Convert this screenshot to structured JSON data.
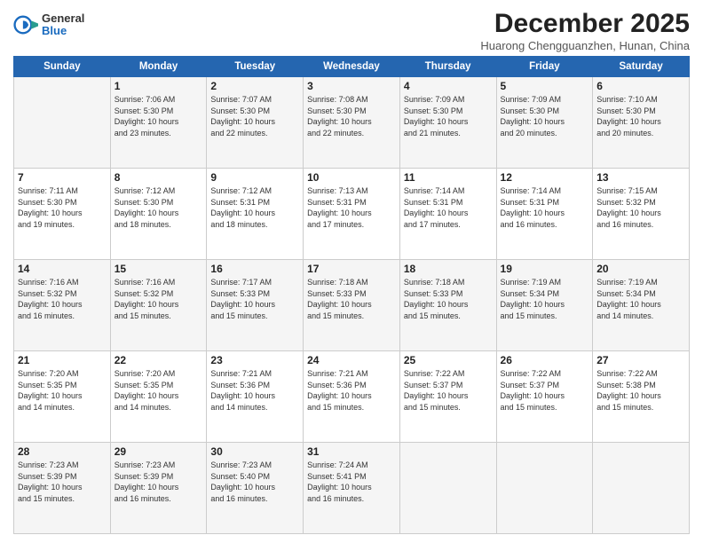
{
  "header": {
    "logo_general": "General",
    "logo_blue": "Blue",
    "month_title": "December 2025",
    "location": "Huarong Chengguanzhen, Hunan, China"
  },
  "days_of_week": [
    "Sunday",
    "Monday",
    "Tuesday",
    "Wednesday",
    "Thursday",
    "Friday",
    "Saturday"
  ],
  "weeks": [
    [
      {
        "day": "",
        "info": ""
      },
      {
        "day": "1",
        "info": "Sunrise: 7:06 AM\nSunset: 5:30 PM\nDaylight: 10 hours\nand 23 minutes."
      },
      {
        "day": "2",
        "info": "Sunrise: 7:07 AM\nSunset: 5:30 PM\nDaylight: 10 hours\nand 22 minutes."
      },
      {
        "day": "3",
        "info": "Sunrise: 7:08 AM\nSunset: 5:30 PM\nDaylight: 10 hours\nand 22 minutes."
      },
      {
        "day": "4",
        "info": "Sunrise: 7:09 AM\nSunset: 5:30 PM\nDaylight: 10 hours\nand 21 minutes."
      },
      {
        "day": "5",
        "info": "Sunrise: 7:09 AM\nSunset: 5:30 PM\nDaylight: 10 hours\nand 20 minutes."
      },
      {
        "day": "6",
        "info": "Sunrise: 7:10 AM\nSunset: 5:30 PM\nDaylight: 10 hours\nand 20 minutes."
      }
    ],
    [
      {
        "day": "7",
        "info": "Sunrise: 7:11 AM\nSunset: 5:30 PM\nDaylight: 10 hours\nand 19 minutes."
      },
      {
        "day": "8",
        "info": "Sunrise: 7:12 AM\nSunset: 5:30 PM\nDaylight: 10 hours\nand 18 minutes."
      },
      {
        "day": "9",
        "info": "Sunrise: 7:12 AM\nSunset: 5:31 PM\nDaylight: 10 hours\nand 18 minutes."
      },
      {
        "day": "10",
        "info": "Sunrise: 7:13 AM\nSunset: 5:31 PM\nDaylight: 10 hours\nand 17 minutes."
      },
      {
        "day": "11",
        "info": "Sunrise: 7:14 AM\nSunset: 5:31 PM\nDaylight: 10 hours\nand 17 minutes."
      },
      {
        "day": "12",
        "info": "Sunrise: 7:14 AM\nSunset: 5:31 PM\nDaylight: 10 hours\nand 16 minutes."
      },
      {
        "day": "13",
        "info": "Sunrise: 7:15 AM\nSunset: 5:32 PM\nDaylight: 10 hours\nand 16 minutes."
      }
    ],
    [
      {
        "day": "14",
        "info": "Sunrise: 7:16 AM\nSunset: 5:32 PM\nDaylight: 10 hours\nand 16 minutes."
      },
      {
        "day": "15",
        "info": "Sunrise: 7:16 AM\nSunset: 5:32 PM\nDaylight: 10 hours\nand 15 minutes."
      },
      {
        "day": "16",
        "info": "Sunrise: 7:17 AM\nSunset: 5:33 PM\nDaylight: 10 hours\nand 15 minutes."
      },
      {
        "day": "17",
        "info": "Sunrise: 7:18 AM\nSunset: 5:33 PM\nDaylight: 10 hours\nand 15 minutes."
      },
      {
        "day": "18",
        "info": "Sunrise: 7:18 AM\nSunset: 5:33 PM\nDaylight: 10 hours\nand 15 minutes."
      },
      {
        "day": "19",
        "info": "Sunrise: 7:19 AM\nSunset: 5:34 PM\nDaylight: 10 hours\nand 15 minutes."
      },
      {
        "day": "20",
        "info": "Sunrise: 7:19 AM\nSunset: 5:34 PM\nDaylight: 10 hours\nand 14 minutes."
      }
    ],
    [
      {
        "day": "21",
        "info": "Sunrise: 7:20 AM\nSunset: 5:35 PM\nDaylight: 10 hours\nand 14 minutes."
      },
      {
        "day": "22",
        "info": "Sunrise: 7:20 AM\nSunset: 5:35 PM\nDaylight: 10 hours\nand 14 minutes."
      },
      {
        "day": "23",
        "info": "Sunrise: 7:21 AM\nSunset: 5:36 PM\nDaylight: 10 hours\nand 14 minutes."
      },
      {
        "day": "24",
        "info": "Sunrise: 7:21 AM\nSunset: 5:36 PM\nDaylight: 10 hours\nand 15 minutes."
      },
      {
        "day": "25",
        "info": "Sunrise: 7:22 AM\nSunset: 5:37 PM\nDaylight: 10 hours\nand 15 minutes."
      },
      {
        "day": "26",
        "info": "Sunrise: 7:22 AM\nSunset: 5:37 PM\nDaylight: 10 hours\nand 15 minutes."
      },
      {
        "day": "27",
        "info": "Sunrise: 7:22 AM\nSunset: 5:38 PM\nDaylight: 10 hours\nand 15 minutes."
      }
    ],
    [
      {
        "day": "28",
        "info": "Sunrise: 7:23 AM\nSunset: 5:39 PM\nDaylight: 10 hours\nand 15 minutes."
      },
      {
        "day": "29",
        "info": "Sunrise: 7:23 AM\nSunset: 5:39 PM\nDaylight: 10 hours\nand 16 minutes."
      },
      {
        "day": "30",
        "info": "Sunrise: 7:23 AM\nSunset: 5:40 PM\nDaylight: 10 hours\nand 16 minutes."
      },
      {
        "day": "31",
        "info": "Sunrise: 7:24 AM\nSunset: 5:41 PM\nDaylight: 10 hours\nand 16 minutes."
      },
      {
        "day": "",
        "info": ""
      },
      {
        "day": "",
        "info": ""
      },
      {
        "day": "",
        "info": ""
      }
    ]
  ]
}
